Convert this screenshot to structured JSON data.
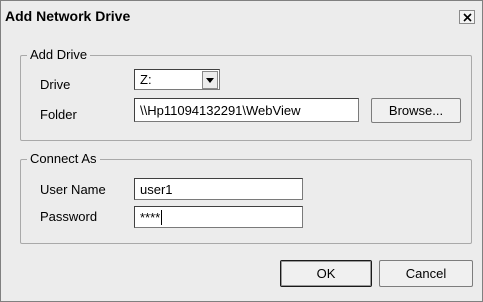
{
  "window": {
    "title": "Add Network Drive",
    "close_label": "×"
  },
  "add_drive": {
    "legend": "Add Drive",
    "drive_label": "Drive",
    "drive_value": "Z:",
    "folder_label": "Folder",
    "folder_value": "\\\\Hp11094132291\\WebView",
    "browse_label": "Browse..."
  },
  "connect_as": {
    "legend": "Connect As",
    "username_label": "User Name",
    "username_value": "user1",
    "password_label": "Password",
    "password_value": "****"
  },
  "buttons": {
    "ok_label": "OK",
    "cancel_label": "Cancel"
  },
  "icons": {
    "close": "close-icon",
    "dropdown": "chevron-down-icon"
  }
}
